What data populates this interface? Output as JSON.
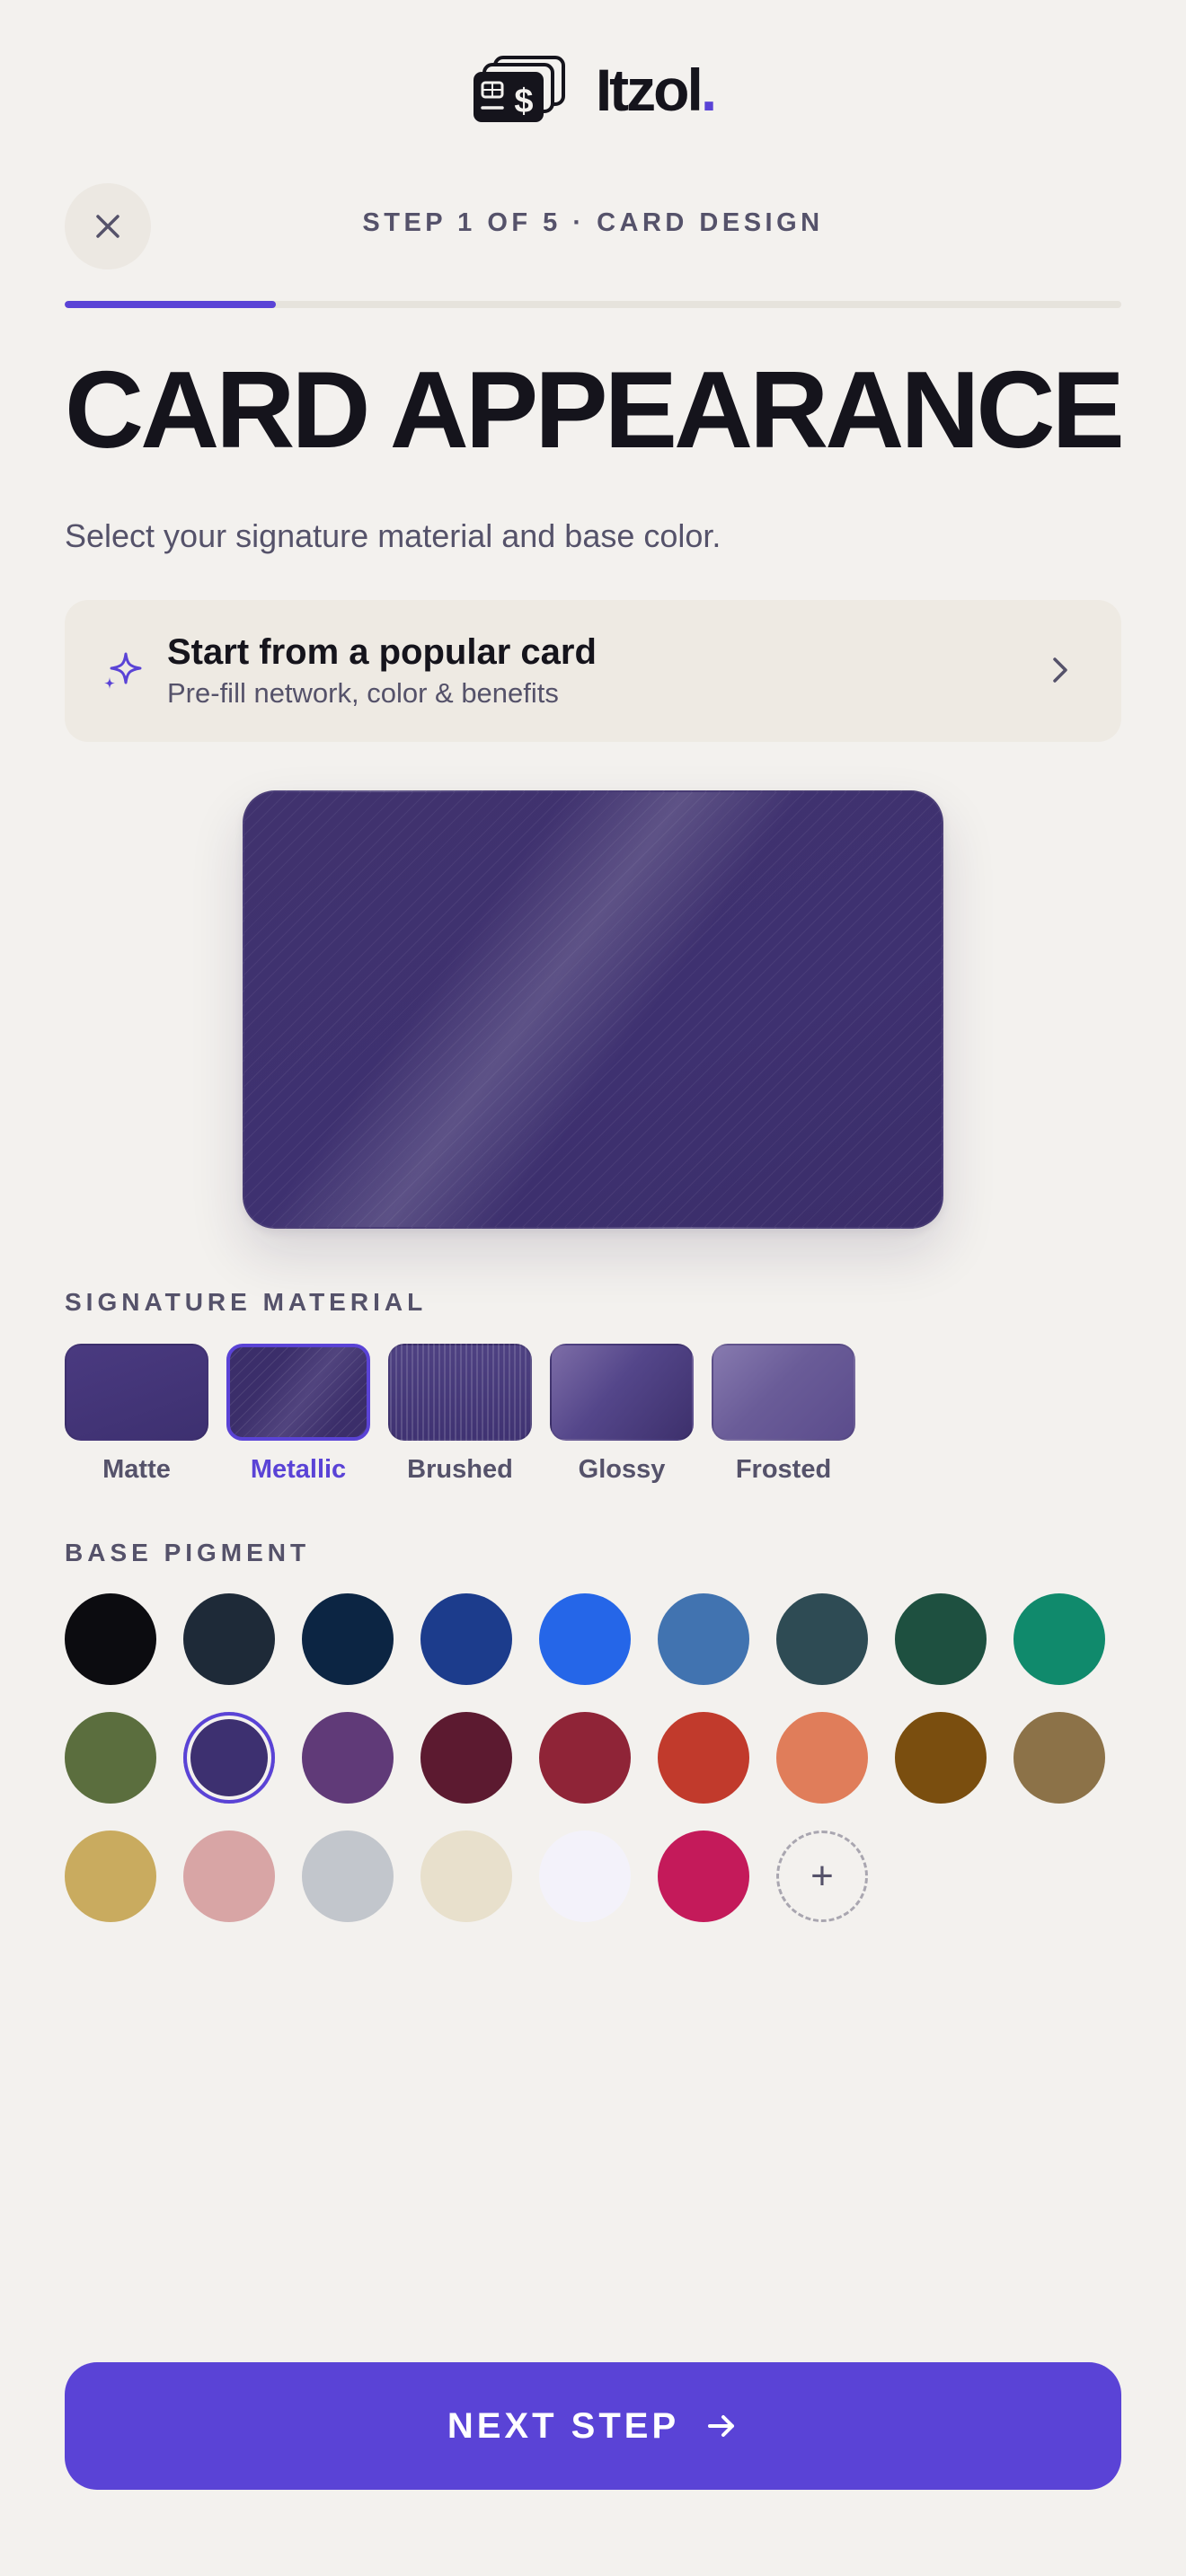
{
  "brand": {
    "name": "Itzol",
    "dot": "."
  },
  "header": {
    "step_label": "STEP 1 OF 5 · CARD DESIGN",
    "progress_fraction": 0.2
  },
  "main": {
    "title": "CARD APPEARANCE",
    "subtitle": "Select your signature material and base color."
  },
  "popular_card": {
    "title": "Start from a popular card",
    "subtitle": "Pre-fill network, color & benefits"
  },
  "materials": {
    "label": "SIGNATURE MATERIAL",
    "selected": "Metallic",
    "items": [
      {
        "label": "Matte"
      },
      {
        "label": "Metallic"
      },
      {
        "label": "Brushed"
      },
      {
        "label": "Glossy"
      },
      {
        "label": "Frosted"
      }
    ]
  },
  "pigments": {
    "label": "BASE PIGMENT",
    "selected_color": "#3d3070",
    "colors": [
      "#0c0c10",
      "#1e2a38",
      "#0c2543",
      "#1c3c8c",
      "#2566e8",
      "#4173b0",
      "#2e4b54",
      "#1e5040",
      "#108a6c",
      "#5b6e3e",
      "#3d3070",
      "#603a78",
      "#5c1a30",
      "#8f2437",
      "#c13a2c",
      "#e07d5a",
      "#7a4e0f",
      "#8c7248",
      "#c9ab5f",
      "#d8a5a5",
      "#c2c6cc",
      "#e8e0cc",
      "#f3f2fa",
      "#c41a5a"
    ],
    "add_label": "+"
  },
  "footer": {
    "next_label": "NEXT STEP"
  },
  "theme": {
    "accent": "#5a43d6",
    "background": "#f3f1ee",
    "text": "#15141c",
    "muted": "#55526a"
  }
}
